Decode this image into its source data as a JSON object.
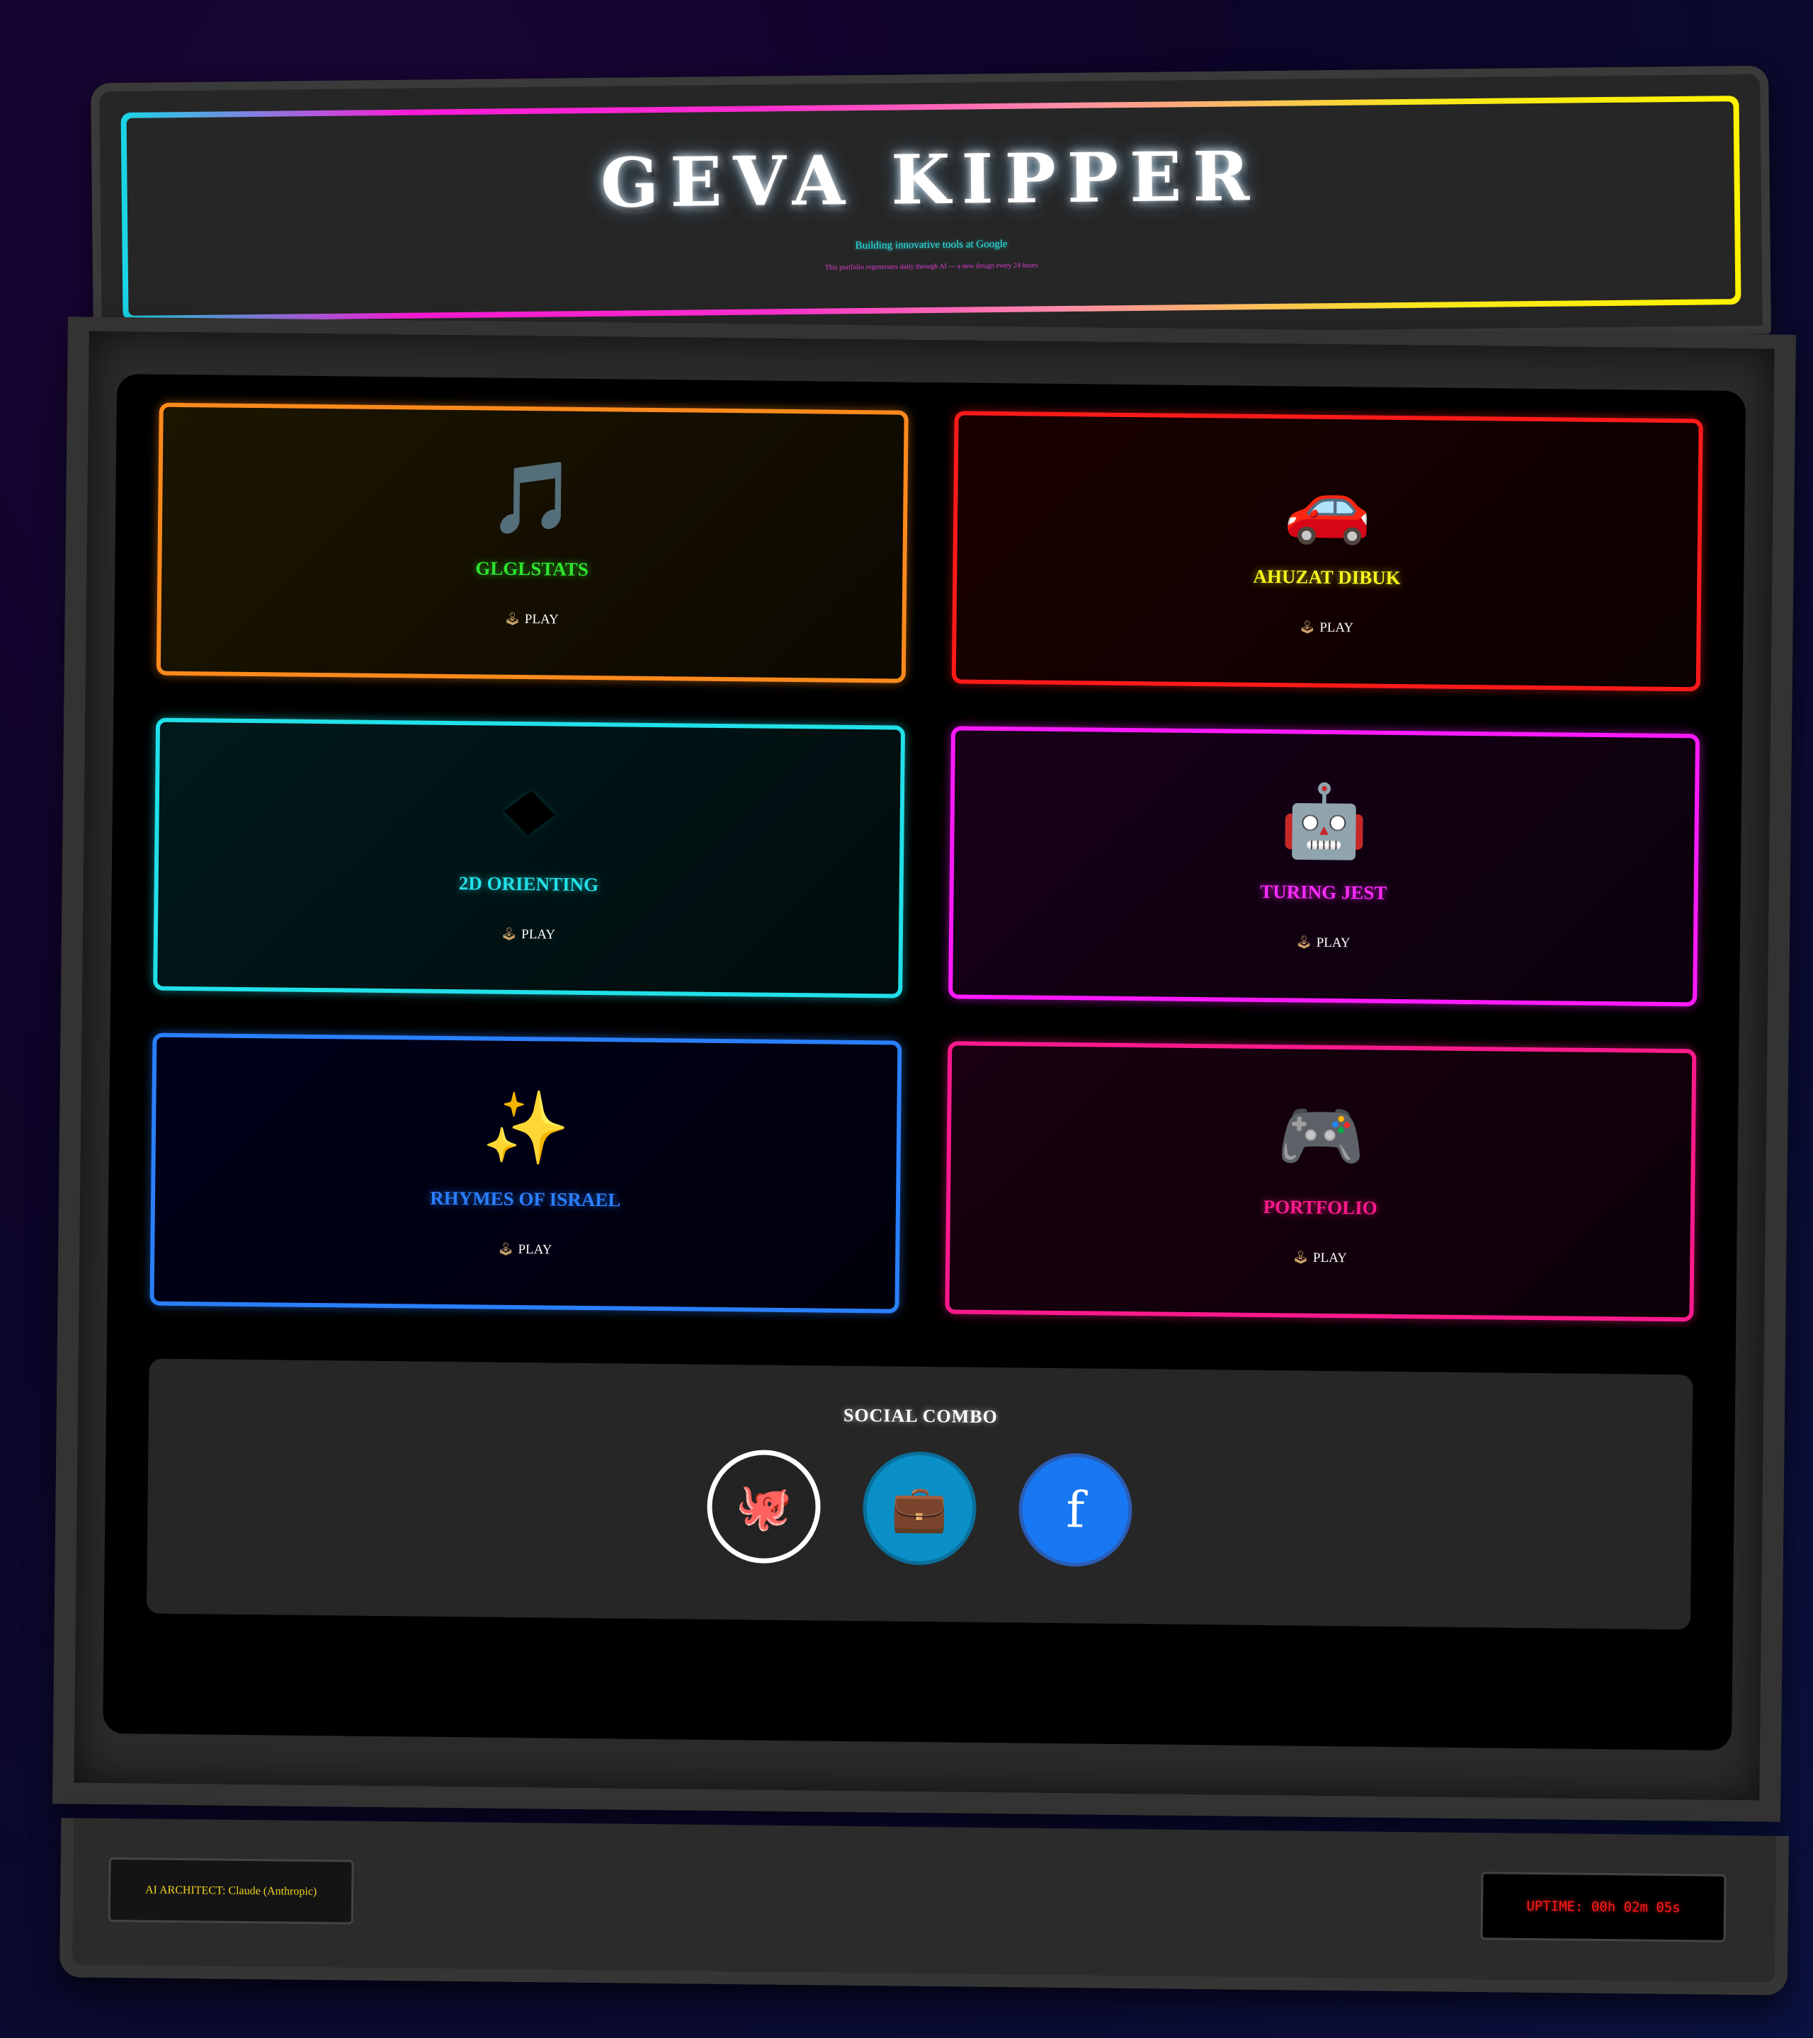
{
  "marquee": {
    "title": "GEVA KIPPER",
    "subtitle": "Building innovative tools at Google",
    "tagline": "This portfolio regenerates daily through AI — a new design every 24 hours"
  },
  "cards": [
    {
      "name": "GLGLSTATS",
      "emoji": "🎵",
      "icon": "music-note-icon",
      "play_label": "PLAY",
      "color": "#ff8a1c"
    },
    {
      "name": "AHUZAT DIBUK",
      "emoji": "🚗",
      "icon": "car-icon",
      "play_label": "PLAY",
      "color": "#ff1a1a"
    },
    {
      "name": "2D ORIENTING",
      "emoji": "",
      "icon": "diamond-icon",
      "play_label": "PLAY",
      "color": "#22e0e8"
    },
    {
      "name": "TURING JEST",
      "emoji": "🤖",
      "icon": "robot-icon",
      "play_label": "PLAY",
      "color": "#ff1aff"
    },
    {
      "name": "RHYMES OF ISRAEL",
      "emoji": "✨",
      "icon": "sparkles-icon",
      "play_label": "PLAY",
      "color": "#2a7fff"
    },
    {
      "name": "PORTFOLIO",
      "emoji": "🎮",
      "icon": "gamepad-icon",
      "play_label": "PLAY",
      "color": "#ff1a8c"
    }
  ],
  "play_icon": "🕹",
  "social": {
    "title": "SOCIAL COMBO",
    "buttons": [
      {
        "name": "github",
        "glyph": "🐙",
        "icon": "octopus-icon"
      },
      {
        "name": "linkedin",
        "glyph": "💼",
        "icon": "briefcase-icon"
      },
      {
        "name": "facebook",
        "glyph": "f",
        "icon": "facebook-icon"
      }
    ]
  },
  "footer": {
    "credit": "AI ARCHITECT: Claude (Anthropic)",
    "uptime": "UPTIME: 00h 02m 05s"
  }
}
